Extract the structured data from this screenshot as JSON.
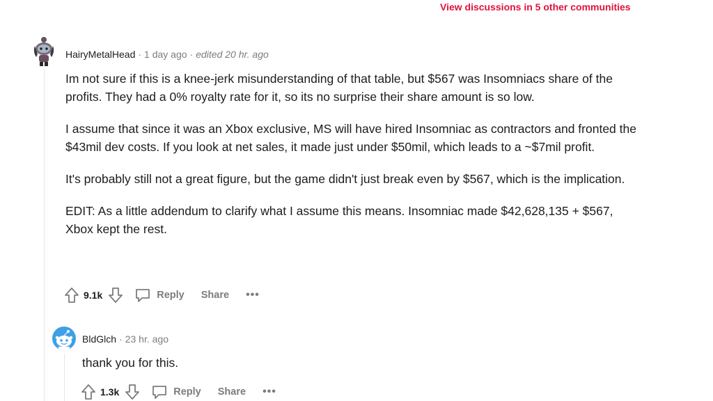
{
  "header": {
    "discussions_link": "View discussions in 5 other communities"
  },
  "comments": [
    {
      "username": "HairyMetalHead",
      "time": "1 day ago",
      "edited": "edited 20 hr. ago",
      "paragraphs": [
        "Im not sure if this is a knee-jerk misunderstanding of that table, but $567 was Insomniacs share of the profits. They had a 0% royalty rate for it, so its no surprise their share amount is so low.",
        "I assume that since it was an Xbox exclusive, MS will have hired Insomniac as contractors and fronted the $43mil dev costs. If you look at net sales, it made just under $50mil, which leads to a ~$7mil profit.",
        "It's probably still not a great figure, but the game didn't just break even by $567, which is the implication.",
        "EDIT: As a little addendum to clarify what I assume this means. Insomniac made $42,628,135 + $567, Xbox kept the rest."
      ],
      "votes": "9.1k",
      "reply_label": "Reply",
      "share_label": "Share",
      "more_label": "•••"
    },
    {
      "username": "BldGlch",
      "time": "23 hr. ago",
      "paragraphs": [
        "thank you for this."
      ],
      "votes": "1.3k",
      "reply_label": "Reply",
      "share_label": "Share",
      "more_label": "•••"
    }
  ],
  "icons": {
    "upvote": "upvote-arrow-icon",
    "downvote": "downvote-arrow-icon",
    "reply": "speech-bubble-icon",
    "more": "more-options-icon"
  },
  "colors": {
    "accent": "#e0123c",
    "muted": "#7c7c7c",
    "text": "#1c1c1c",
    "thread_line": "#e4e6e8",
    "avatar_blue": "#3ea0e6"
  },
  "sep": "·"
}
